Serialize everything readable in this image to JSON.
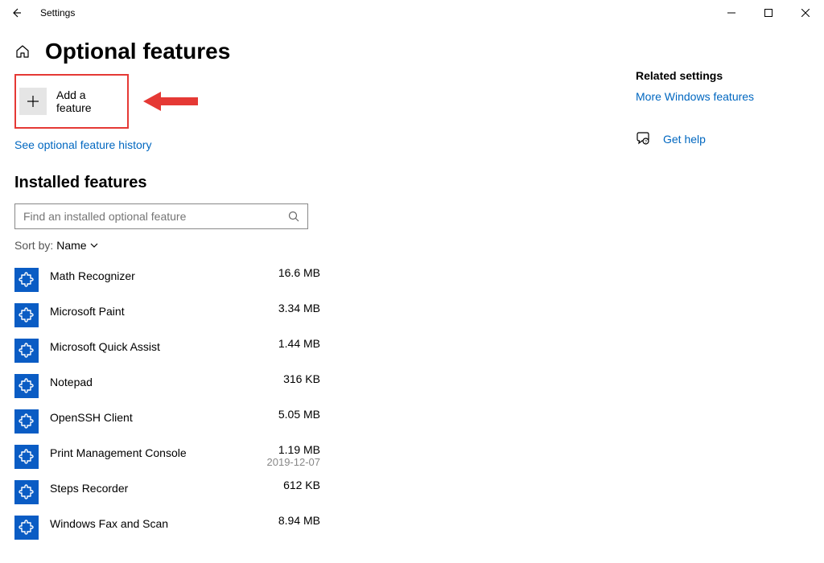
{
  "titlebar": {
    "app_name": "Settings"
  },
  "page": {
    "title": "Optional features",
    "add_feature_label": "Add a feature",
    "history_link": "See optional feature history",
    "installed_heading": "Installed features",
    "search_placeholder": "Find an installed optional feature",
    "sort_label": "Sort by:",
    "sort_value": "Name"
  },
  "features": [
    {
      "name": "Math Recognizer",
      "size": "16.6 MB",
      "date": ""
    },
    {
      "name": "Microsoft Paint",
      "size": "3.34 MB",
      "date": ""
    },
    {
      "name": "Microsoft Quick Assist",
      "size": "1.44 MB",
      "date": ""
    },
    {
      "name": "Notepad",
      "size": "316 KB",
      "date": ""
    },
    {
      "name": "OpenSSH Client",
      "size": "5.05 MB",
      "date": ""
    },
    {
      "name": "Print Management Console",
      "size": "1.19 MB",
      "date": "2019-12-07"
    },
    {
      "name": "Steps Recorder",
      "size": "612 KB",
      "date": ""
    },
    {
      "name": "Windows Fax and Scan",
      "size": "8.94 MB",
      "date": ""
    }
  ],
  "aside": {
    "related_heading": "Related settings",
    "more_windows_link": "More Windows features",
    "get_help_link": "Get help"
  },
  "colors": {
    "accent": "#0067c0",
    "feature_tile": "#0a5cc4",
    "highlight_border": "#e53935"
  }
}
